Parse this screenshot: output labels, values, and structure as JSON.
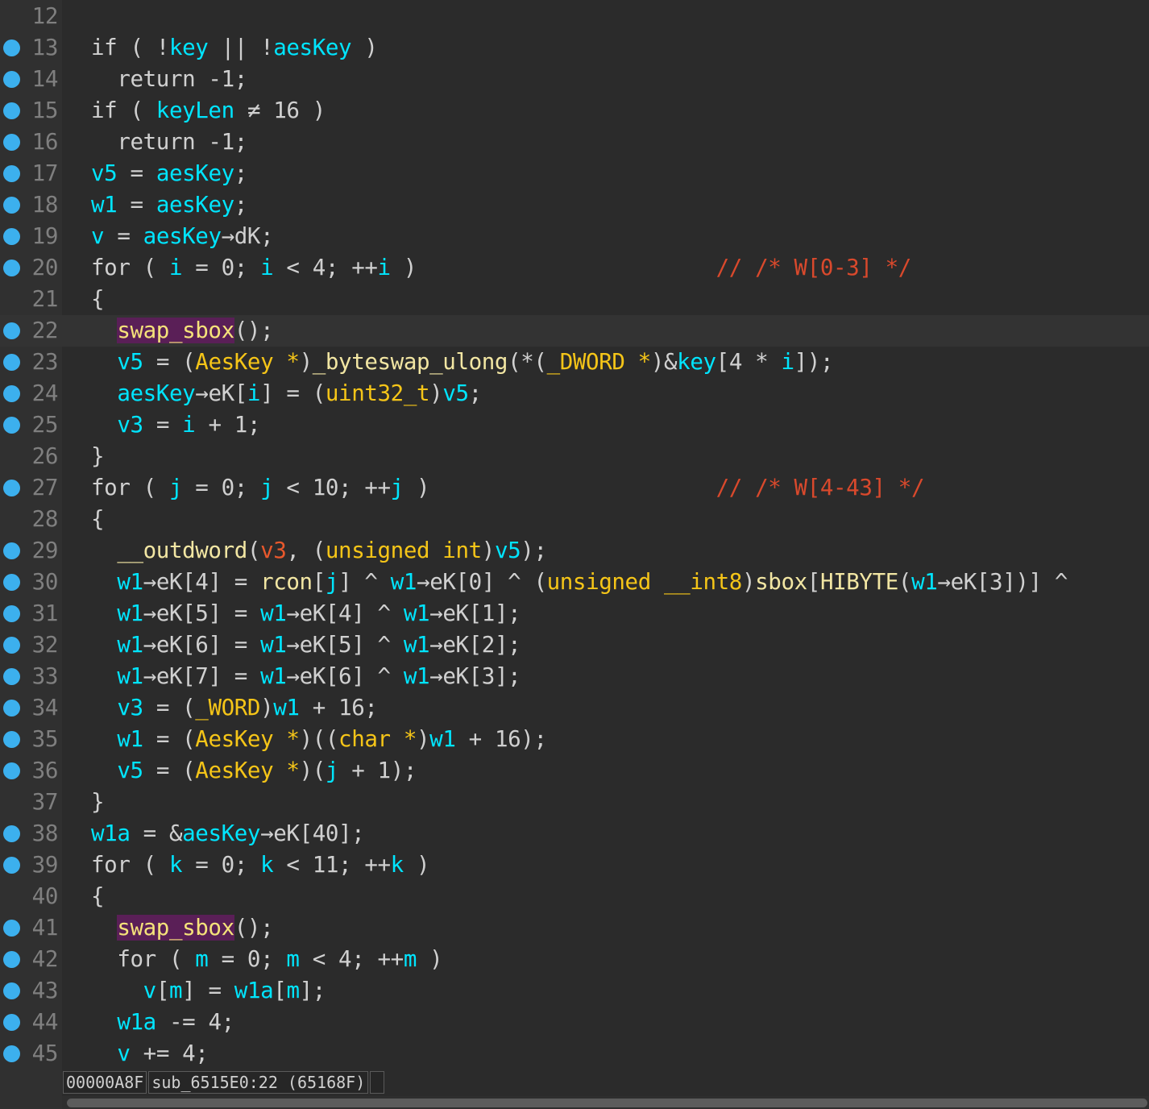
{
  "colors": {
    "background": "#2b2b2b",
    "breakpoint": "#3cb0ee",
    "identifier": "#00e5ff",
    "type": "#f5c518",
    "comment": "#d9492c",
    "highlight": "#5a1f57"
  },
  "lines": [
    {
      "n": "12",
      "bp": false,
      "tokens": []
    },
    {
      "n": "13",
      "bp": true,
      "tokens": [
        [
          "k",
          "if ( !"
        ],
        [
          "v",
          "key"
        ],
        [
          "k",
          " || !"
        ],
        [
          "v",
          "aesKey"
        ],
        [
          "k",
          " )"
        ]
      ]
    },
    {
      "n": "14",
      "bp": true,
      "tokens": [
        [
          "k",
          "  return -1;"
        ]
      ]
    },
    {
      "n": "15",
      "bp": true,
      "tokens": [
        [
          "k",
          "if ( "
        ],
        [
          "v",
          "keyLen"
        ],
        [
          "k",
          " ≠ 16 )"
        ]
      ]
    },
    {
      "n": "16",
      "bp": true,
      "tokens": [
        [
          "k",
          "  return -1;"
        ]
      ]
    },
    {
      "n": "17",
      "bp": true,
      "tokens": [
        [
          "v",
          "v5"
        ],
        [
          "k",
          " = "
        ],
        [
          "v",
          "aesKey"
        ],
        [
          "k",
          ";"
        ]
      ]
    },
    {
      "n": "18",
      "bp": true,
      "tokens": [
        [
          "v",
          "w1"
        ],
        [
          "k",
          " = "
        ],
        [
          "v",
          "aesKey"
        ],
        [
          "k",
          ";"
        ]
      ]
    },
    {
      "n": "19",
      "bp": true,
      "tokens": [
        [
          "v",
          "v"
        ],
        [
          "k",
          " = "
        ],
        [
          "v",
          "aesKey"
        ],
        [
          "k",
          "→dK;"
        ]
      ]
    },
    {
      "n": "20",
      "bp": true,
      "tokens": [
        [
          "k",
          "for ( "
        ],
        [
          "v",
          "i"
        ],
        [
          "k",
          " = 0; "
        ],
        [
          "v",
          "i"
        ],
        [
          "k",
          " < 4; ++"
        ],
        [
          "v",
          "i"
        ],
        [
          "k",
          " )                       "
        ],
        [
          "c",
          "// /* W[0-3] */"
        ]
      ]
    },
    {
      "n": "21",
      "bp": false,
      "tokens": [
        [
          "k",
          "{"
        ]
      ]
    },
    {
      "n": "22",
      "bp": true,
      "current": true,
      "tokens": [
        [
          "k",
          "  "
        ],
        [
          "h",
          "swap_sbox"
        ],
        [
          "k",
          "();"
        ]
      ]
    },
    {
      "n": "23",
      "bp": true,
      "tokens": [
        [
          "k",
          "  "
        ],
        [
          "v",
          "v5"
        ],
        [
          "k",
          " = ("
        ],
        [
          "t",
          "AesKey *"
        ],
        [
          "k",
          ")"
        ],
        [
          "f",
          "_byteswap_ulong"
        ],
        [
          "k",
          "(*("
        ],
        [
          "t",
          "_DWORD *"
        ],
        [
          "k",
          ")&"
        ],
        [
          "v",
          "key"
        ],
        [
          "k",
          "[4 * "
        ],
        [
          "v",
          "i"
        ],
        [
          "k",
          "]);"
        ]
      ]
    },
    {
      "n": "24",
      "bp": true,
      "tokens": [
        [
          "k",
          "  "
        ],
        [
          "v",
          "aesKey"
        ],
        [
          "k",
          "→eK["
        ],
        [
          "v",
          "i"
        ],
        [
          "k",
          "] = ("
        ],
        [
          "t",
          "uint32_t"
        ],
        [
          "k",
          ")"
        ],
        [
          "v",
          "v5"
        ],
        [
          "k",
          ";"
        ]
      ]
    },
    {
      "n": "25",
      "bp": true,
      "tokens": [
        [
          "k",
          "  "
        ],
        [
          "v",
          "v3"
        ],
        [
          "k",
          " = "
        ],
        [
          "v",
          "i"
        ],
        [
          "k",
          " + 1;"
        ]
      ]
    },
    {
      "n": "26",
      "bp": false,
      "tokens": [
        [
          "k",
          "}"
        ]
      ]
    },
    {
      "n": "27",
      "bp": true,
      "tokens": [
        [
          "k",
          "for ( "
        ],
        [
          "v",
          "j"
        ],
        [
          "k",
          " = 0; "
        ],
        [
          "v",
          "j"
        ],
        [
          "k",
          " < 10; ++"
        ],
        [
          "v",
          "j"
        ],
        [
          "k",
          " )                      "
        ],
        [
          "c",
          "// /* W[4-43] */"
        ]
      ]
    },
    {
      "n": "28",
      "bp": false,
      "tokens": [
        [
          "k",
          "{"
        ]
      ]
    },
    {
      "n": "29",
      "bp": true,
      "tokens": [
        [
          "k",
          "  "
        ],
        [
          "f",
          "__outdword"
        ],
        [
          "k",
          "("
        ],
        [
          "a",
          "v3"
        ],
        [
          "k",
          ", ("
        ],
        [
          "t",
          "unsigned int"
        ],
        [
          "k",
          ")"
        ],
        [
          "v",
          "v5"
        ],
        [
          "k",
          ");"
        ]
      ]
    },
    {
      "n": "30",
      "bp": true,
      "tokens": [
        [
          "k",
          "  "
        ],
        [
          "v",
          "w1"
        ],
        [
          "k",
          "→eK[4] = "
        ],
        [
          "f",
          "rcon"
        ],
        [
          "k",
          "["
        ],
        [
          "v",
          "j"
        ],
        [
          "k",
          "] ^ "
        ],
        [
          "v",
          "w1"
        ],
        [
          "k",
          "→eK[0] ^ ("
        ],
        [
          "t",
          "unsigned __int8"
        ],
        [
          "k",
          ")"
        ],
        [
          "f",
          "sbox"
        ],
        [
          "k",
          "["
        ],
        [
          "f",
          "HIBYTE"
        ],
        [
          "k",
          "("
        ],
        [
          "v",
          "w1"
        ],
        [
          "k",
          "→eK[3])] ^"
        ]
      ]
    },
    {
      "n": "31",
      "bp": true,
      "tokens": [
        [
          "k",
          "  "
        ],
        [
          "v",
          "w1"
        ],
        [
          "k",
          "→eK[5] = "
        ],
        [
          "v",
          "w1"
        ],
        [
          "k",
          "→eK[4] ^ "
        ],
        [
          "v",
          "w1"
        ],
        [
          "k",
          "→eK[1];"
        ]
      ]
    },
    {
      "n": "32",
      "bp": true,
      "tokens": [
        [
          "k",
          "  "
        ],
        [
          "v",
          "w1"
        ],
        [
          "k",
          "→eK[6] = "
        ],
        [
          "v",
          "w1"
        ],
        [
          "k",
          "→eK[5] ^ "
        ],
        [
          "v",
          "w1"
        ],
        [
          "k",
          "→eK[2];"
        ]
      ]
    },
    {
      "n": "33",
      "bp": true,
      "tokens": [
        [
          "k",
          "  "
        ],
        [
          "v",
          "w1"
        ],
        [
          "k",
          "→eK[7] = "
        ],
        [
          "v",
          "w1"
        ],
        [
          "k",
          "→eK[6] ^ "
        ],
        [
          "v",
          "w1"
        ],
        [
          "k",
          "→eK[3];"
        ]
      ]
    },
    {
      "n": "34",
      "bp": true,
      "tokens": [
        [
          "k",
          "  "
        ],
        [
          "v",
          "v3"
        ],
        [
          "k",
          " = ("
        ],
        [
          "t",
          "_WORD"
        ],
        [
          "k",
          ")"
        ],
        [
          "v",
          "w1"
        ],
        [
          "k",
          " + 16;"
        ]
      ]
    },
    {
      "n": "35",
      "bp": true,
      "tokens": [
        [
          "k",
          "  "
        ],
        [
          "v",
          "w1"
        ],
        [
          "k",
          " = ("
        ],
        [
          "t",
          "AesKey *"
        ],
        [
          "k",
          ")(("
        ],
        [
          "t",
          "char *"
        ],
        [
          "k",
          ")"
        ],
        [
          "v",
          "w1"
        ],
        [
          "k",
          " + 16);"
        ]
      ]
    },
    {
      "n": "36",
      "bp": true,
      "tokens": [
        [
          "k",
          "  "
        ],
        [
          "v",
          "v5"
        ],
        [
          "k",
          " = ("
        ],
        [
          "t",
          "AesKey *"
        ],
        [
          "k",
          ")("
        ],
        [
          "v",
          "j"
        ],
        [
          "k",
          " + 1);"
        ]
      ]
    },
    {
      "n": "37",
      "bp": false,
      "tokens": [
        [
          "k",
          "}"
        ]
      ]
    },
    {
      "n": "38",
      "bp": true,
      "tokens": [
        [
          "v",
          "w1a"
        ],
        [
          "k",
          " = &"
        ],
        [
          "v",
          "aesKey"
        ],
        [
          "k",
          "→eK[40];"
        ]
      ]
    },
    {
      "n": "39",
      "bp": true,
      "tokens": [
        [
          "k",
          "for ( "
        ],
        [
          "v",
          "k"
        ],
        [
          "k",
          " = 0; "
        ],
        [
          "v",
          "k"
        ],
        [
          "k",
          " < 11; ++"
        ],
        [
          "v",
          "k"
        ],
        [
          "k",
          " )"
        ]
      ]
    },
    {
      "n": "40",
      "bp": false,
      "tokens": [
        [
          "k",
          "{"
        ]
      ]
    },
    {
      "n": "41",
      "bp": true,
      "tokens": [
        [
          "k",
          "  "
        ],
        [
          "h",
          "swap_sbox"
        ],
        [
          "k",
          "();"
        ]
      ]
    },
    {
      "n": "42",
      "bp": true,
      "tokens": [
        [
          "k",
          "  for ( "
        ],
        [
          "v",
          "m"
        ],
        [
          "k",
          " = 0; "
        ],
        [
          "v",
          "m"
        ],
        [
          "k",
          " < 4; ++"
        ],
        [
          "v",
          "m"
        ],
        [
          "k",
          " )"
        ]
      ]
    },
    {
      "n": "43",
      "bp": true,
      "tokens": [
        [
          "k",
          "    "
        ],
        [
          "v",
          "v"
        ],
        [
          "k",
          "["
        ],
        [
          "v",
          "m"
        ],
        [
          "k",
          "] = "
        ],
        [
          "v",
          "w1a"
        ],
        [
          "k",
          "["
        ],
        [
          "v",
          "m"
        ],
        [
          "k",
          "];"
        ]
      ]
    },
    {
      "n": "44",
      "bp": true,
      "tokens": [
        [
          "k",
          "  "
        ],
        [
          "v",
          "w1a"
        ],
        [
          "k",
          " -= 4;"
        ]
      ]
    },
    {
      "n": "45",
      "bp": true,
      "tokens": [
        [
          "k",
          "  "
        ],
        [
          "v",
          "v"
        ],
        [
          "k",
          " += 4;"
        ]
      ]
    }
  ],
  "status": {
    "address": "00000A8F",
    "location": "sub_6515E0:22 (65168F)"
  }
}
